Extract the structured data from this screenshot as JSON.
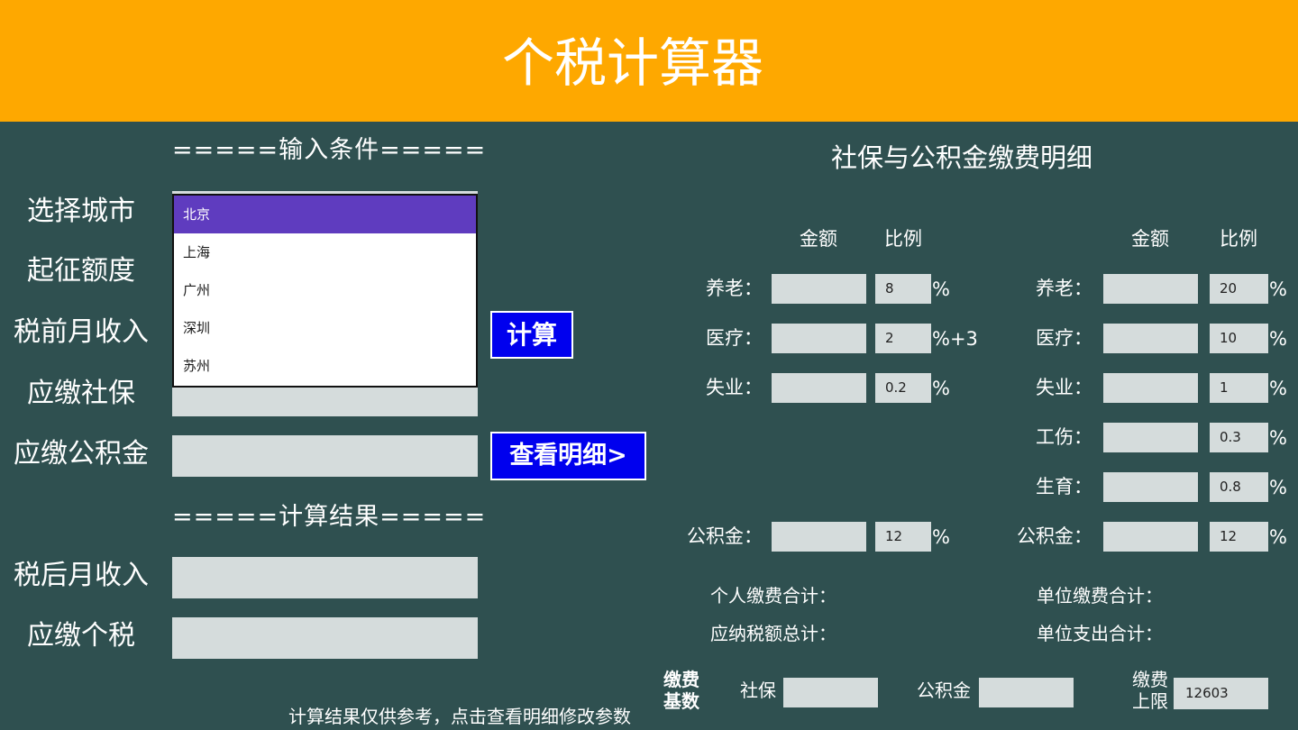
{
  "header": {
    "title": "个税计算器"
  },
  "input_section": {
    "title": "=====输入条件=====",
    "city_label": "选择城市",
    "threshold_label": "起征额度",
    "pretax_label": "税前月收入",
    "social_label": "应缴社保",
    "fund_label": "应缴公积金",
    "calc_button": "计算",
    "detail_button": "查看明细>"
  },
  "city_dropdown": {
    "options": [
      "北京",
      "上海",
      "广州",
      "深圳",
      "苏州"
    ],
    "selected": "北京"
  },
  "result_section": {
    "title": "=====计算结果=====",
    "aftertax_label": "税后月收入",
    "tax_label": "应缴个税"
  },
  "detail_panel": {
    "title": "社保与公积金缴费明细",
    "amount_header": "金额",
    "ratio_header": "比例",
    "personal": {
      "pension_label": "养老：",
      "pension_ratio": "8",
      "pension_unit": "%",
      "medical_label": "医疗：",
      "medical_ratio": "2",
      "medical_unit": "%+3",
      "unemployment_label": "失业：",
      "unemployment_ratio": "0.2",
      "unemployment_unit": "%",
      "fund_label": "公积金：",
      "fund_ratio": "12",
      "fund_unit": "%"
    },
    "company": {
      "pension_label": "养老：",
      "pension_ratio": "20",
      "pension_unit": "%",
      "medical_label": "医疗：",
      "medical_ratio": "10",
      "medical_unit": "%",
      "unemployment_label": "失业：",
      "unemployment_ratio": "1",
      "unemployment_unit": "%",
      "injury_label": "工伤：",
      "injury_ratio": "0.3",
      "injury_unit": "%",
      "maternity_label": "生育：",
      "maternity_ratio": "0.8",
      "maternity_unit": "%",
      "fund_label": "公积金：",
      "fund_ratio": "12",
      "fund_unit": "%"
    },
    "personal_total_label": "个人缴费合计：",
    "taxable_total_label": "应纳税额总计：",
    "company_total_label": "单位缴费合计：",
    "company_expense_label": "单位支出合计：",
    "base_label_line1": "缴费",
    "base_label_line2": "基数",
    "social_base_label": "社保",
    "fund_base_label": "公积金",
    "cap_label_line1": "缴费",
    "cap_label_line2": "上限",
    "cap_value": "12603"
  },
  "footer": {
    "note": "计算结果仅供参考，点击查看明细修改参数"
  },
  "colors": {
    "header_bg": "#fea800",
    "page_bg": "#2f5050",
    "field_bg": "#d5dcdc",
    "button_bg": "#0000ee",
    "dropdown_selected_bg": "#5f3cbf"
  }
}
